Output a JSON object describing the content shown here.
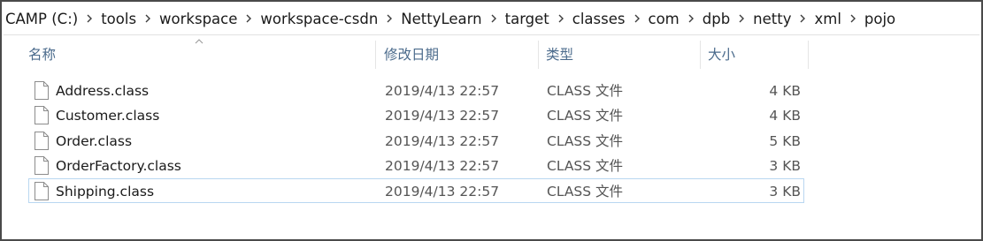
{
  "breadcrumb": [
    "CAMP (C:)",
    "tools",
    "workspace",
    "workspace-csdn",
    "NettyLearn",
    "target",
    "classes",
    "com",
    "dpb",
    "netty",
    "xml",
    "pojo"
  ],
  "columns": {
    "name": "名称",
    "date": "修改日期",
    "type": "类型",
    "size": "大小"
  },
  "files": [
    {
      "name": "Address.class",
      "date": "2019/4/13 22:57",
      "type": "CLASS 文件",
      "size": "4 KB"
    },
    {
      "name": "Customer.class",
      "date": "2019/4/13 22:57",
      "type": "CLASS 文件",
      "size": "4 KB"
    },
    {
      "name": "Order.class",
      "date": "2019/4/13 22:57",
      "type": "CLASS 文件",
      "size": "5 KB"
    },
    {
      "name": "OrderFactory.class",
      "date": "2019/4/13 22:57",
      "type": "CLASS 文件",
      "size": "3 KB"
    },
    {
      "name": "Shipping.class",
      "date": "2019/4/13 22:57",
      "type": "CLASS 文件",
      "size": "3 KB"
    }
  ],
  "sort": {
    "column": "name",
    "direction": "ascending"
  },
  "icons": {
    "separator": "chevron-right-icon",
    "sort": "sort-ascending-icon",
    "file": "file-icon"
  },
  "colors": {
    "header_text": "#4b6b8c",
    "focus_border": "#b9d7f1",
    "frame_border": "#4a4a4a"
  }
}
